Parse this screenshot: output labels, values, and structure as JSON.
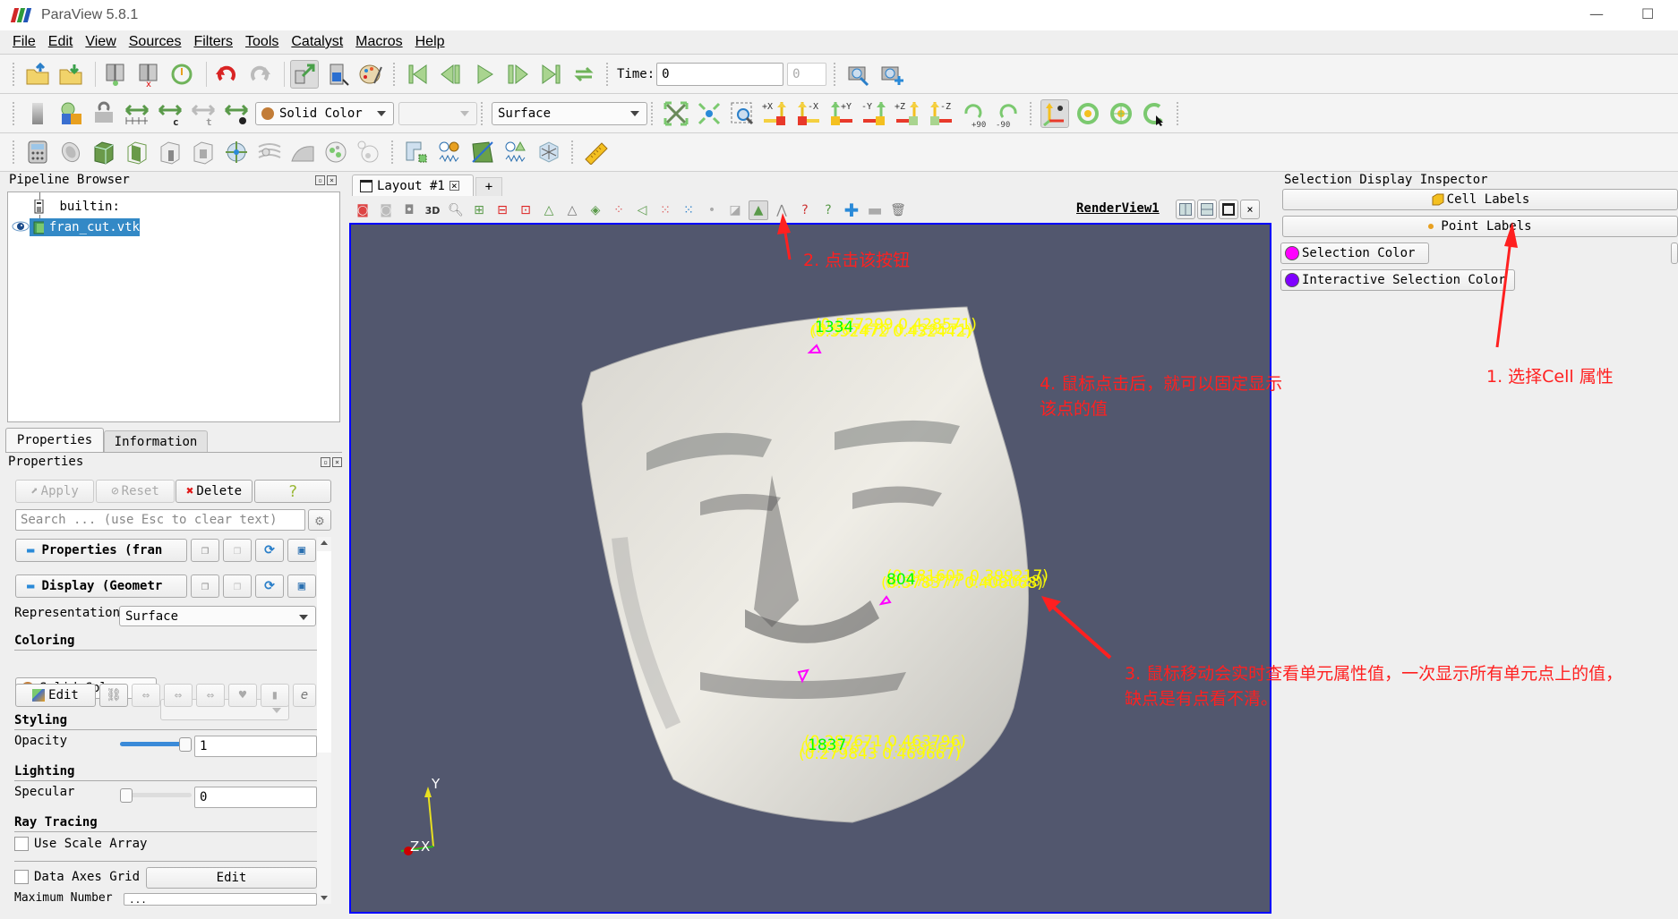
{
  "window": {
    "title": "ParaView 5.8.1",
    "minimize_glyph": "—",
    "maximize_glyph": "☐"
  },
  "menu": [
    {
      "label": "File",
      "mnemonic": "F"
    },
    {
      "label": "Edit",
      "mnemonic": "E"
    },
    {
      "label": "View",
      "mnemonic": "V"
    },
    {
      "label": "Sources",
      "mnemonic": "S"
    },
    {
      "label": "Filters",
      "mnemonic": "l"
    },
    {
      "label": "Tools",
      "mnemonic": "T"
    },
    {
      "label": "Catalyst",
      "mnemonic": "C"
    },
    {
      "label": "Macros",
      "mnemonic": "M"
    },
    {
      "label": "Help",
      "mnemonic": "H"
    }
  ],
  "toolbar1": {
    "icons": [
      "open-file-icon",
      "save-data-icon",
      "connect-icon",
      "disconnect-icon",
      "reset-session-icon",
      "undo-icon",
      "redo-icon",
      "auto-apply-icon",
      "find-data-icon",
      "color-palette-icon"
    ],
    "vcr_icons": [
      "first-frame-icon",
      "previous-frame-icon",
      "play-icon",
      "next-frame-icon",
      "last-frame-icon",
      "loop-icon"
    ],
    "time_label": "Time:",
    "time_value": "0",
    "timestep_value": "0",
    "camera_icons": [
      "capture-screenshot-icon",
      "add-camera-link-icon"
    ]
  },
  "toolbar2": {
    "icons": [
      "toggle-color-legend-icon",
      "edit-color-map-icon",
      "reset-range-icon",
      "rescale-custom-range-icon",
      "rescale-range-over-time-icon",
      "rescale-temporal-range-icon",
      "rescale-visible-range-icon"
    ],
    "coloring_value": "Solid Color",
    "coloring_color": "#c27c37",
    "component_value": "",
    "representation_value": "Surface",
    "camera_icons": [
      "reset-camera-icon",
      "zoom-to-data-icon",
      "zoom-to-box-icon",
      "view-plus-x-icon",
      "view-minus-x-icon",
      "view-plus-y-icon",
      "view-minus-y-icon",
      "view-plus-z-icon",
      "view-minus-z-icon",
      "rotate-plus-90-icon",
      "rotate-minus-90-icon"
    ],
    "camera_labels": {
      "plus_x": "+X",
      "minus_x": "-X",
      "plus_y": "+Y",
      "minus_y": "-Y",
      "plus_z": "+Z",
      "minus_z": "-Z",
      "rot_plus": "+90",
      "rot_minus": "-90"
    },
    "interaction_icons": [
      "orientation-axes-icon",
      "center-of-rotation-icon",
      "reset-center-icon",
      "pick-center-icon"
    ]
  },
  "toolbar3": {
    "icons": [
      "calculator-icon",
      "contour-icon",
      "clip-icon",
      "slice-icon",
      "threshold-icon",
      "extract-subset-icon",
      "glyph-icon",
      "stream-tracer-icon",
      "warp-by-vector-icon",
      "group-datasets-icon",
      "extract-level-icon",
      "extract-selection-icon",
      "plot-selection-over-time-icon",
      "plot-over-line-icon",
      "plot-data-over-time-icon",
      "find-data-icon",
      "ruler-icon"
    ]
  },
  "pipeline": {
    "title": "Pipeline Browser",
    "items": [
      {
        "label": "builtin:",
        "icon": "server-icon",
        "selected": false
      },
      {
        "label": "fran_cut.vtk",
        "icon": "dataset-icon",
        "selected": true,
        "visible": true
      }
    ]
  },
  "properties": {
    "tabs": [
      {
        "label": "Properties",
        "active": true
      },
      {
        "label": "Information",
        "active": false
      }
    ],
    "title": "Properties",
    "buttons": {
      "apply": "Apply",
      "reset": "Reset",
      "delete": "Delete",
      "help": "?"
    },
    "search_placeholder": "Search ... (use Esc to clear text)",
    "group_properties": "Properties (fran",
    "group_display": "Display (Geometr",
    "representation_label": "Representation",
    "representation_value": "Surface",
    "coloring_header": "Coloring",
    "coloring_value": "Solid Color",
    "coloring_color": "#c27c37",
    "edit_label": "Edit",
    "styling_header": "Styling",
    "opacity_label": "Opacity",
    "opacity_value": "1",
    "opacity_fraction": 1.0,
    "lighting_header": "Lighting",
    "specular_label": "Specular",
    "specular_value": "0",
    "specular_fraction": 0.0,
    "raytracing_header": "Ray Tracing",
    "use_scale_array_label": "Use Scale Array",
    "use_scale_array_checked": false,
    "data_axes_grid_label": "Data Axes Grid",
    "data_axes_grid_checked": false,
    "data_axes_edit": "Edit",
    "max_number_label": "Maximum Number",
    "max_number_value": "..."
  },
  "layout": {
    "tab_label": "Layout #1",
    "add_tab": "+",
    "view_name": "RenderView1",
    "view_toolbar_icons": [
      "reset-session-icon",
      "show-frame-icon",
      "capture-icon",
      "toggle-3d-icon",
      "zoom-to-box-icon",
      "select-cells-on-icon",
      "select-points-on-icon",
      "select-cells-frustum-icon",
      "select-points-frustum-icon",
      "select-block-icon",
      "select-cells-polygon-icon",
      "select-points-polygon-icon",
      "interactive-select-cells-icon",
      "interactive-select-points-icon",
      "hover-points-icon",
      "hover-cells-icon",
      "grow-selection-icon",
      "shrink-selection-icon",
      "clear-selection-icon"
    ],
    "threed_label": "3D",
    "background_color": "#52576e",
    "axes": {
      "y": "Y",
      "z": "Z",
      "x": "X"
    }
  },
  "cell_labels": [
    {
      "id": "1334",
      "lines": [
        "(0.577299 0.428571)",
        "(0.552472 0.432442)",
        "(0.567470 0.428571)"
      ]
    },
    {
      "id": "804",
      "lines": [
        "(0.381605 0.399217)",
        "(0.378377 0.408068)",
        "(0.378777 0.402028)"
      ]
    },
    {
      "id": "1837",
      "lines": [
        "(0.287671 0.463796)",
        "(0.279843 0.469667)",
        "(0.287671 0.469667)"
      ]
    }
  ],
  "selection_inspector": {
    "title": "Selection Display Inspector",
    "cell_labels": "Cell Labels",
    "point_labels": "Point Labels",
    "selection_color_label": "Selection Color",
    "selection_color": "#ff00ff",
    "interactive_color_label": "Interactive Selection Color",
    "interactive_color": "#7f00ff"
  },
  "annotations": {
    "step1": "1. 选择Cell 属性",
    "step2": "2. 点击该按钮",
    "step3_line1": "3. 鼠标移动会实时查看单元属性值，一次显示所有单元点上的值，",
    "step3_line2": "缺点是有点看不清。",
    "step4_line1": "4. 鼠标点击后，就可以固定显示",
    "step4_line2": "该点的值",
    "color": "#ff2020"
  }
}
